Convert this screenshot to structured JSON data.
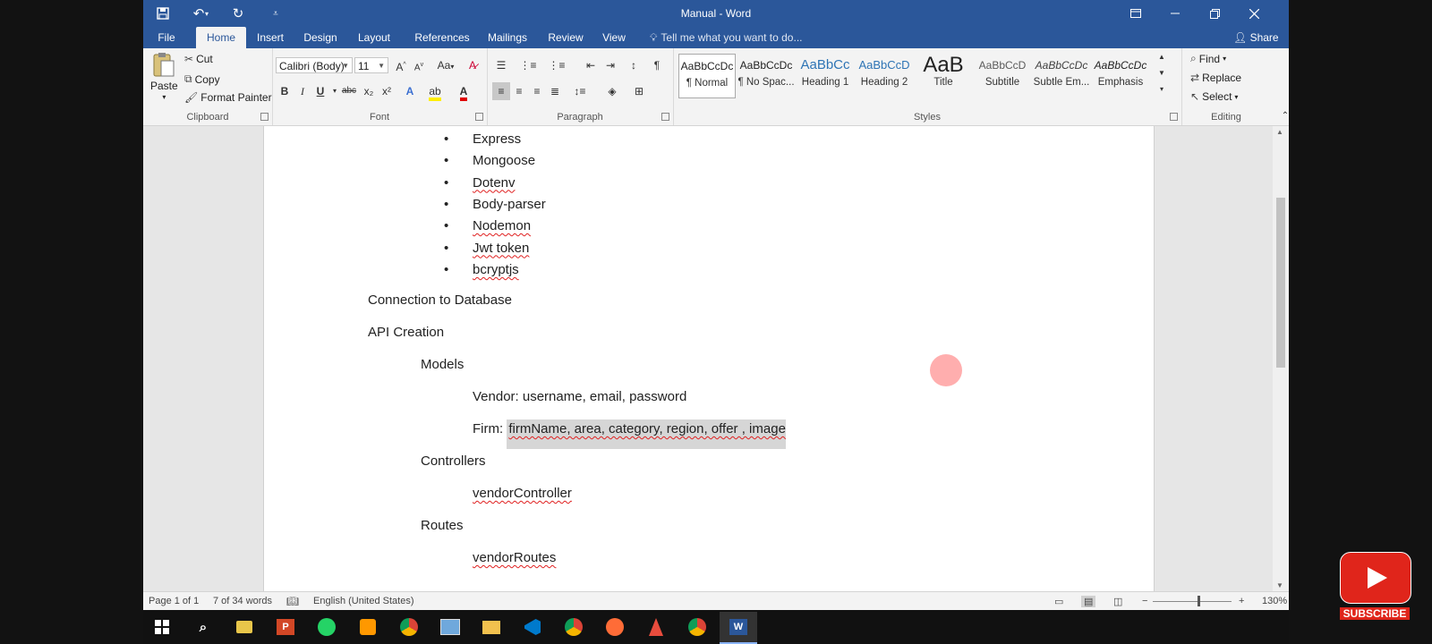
{
  "window": {
    "title": "Manual - Word",
    "quick_access": [
      "save-icon",
      "undo-icon",
      "redo-icon",
      "customize-icon"
    ],
    "controls": [
      "ribbon-display-icon",
      "minimize-icon",
      "restore-icon",
      "close-icon"
    ]
  },
  "tabs": {
    "file": "File",
    "home": "Home",
    "insert": "Insert",
    "design": "Design",
    "layout": "Layout",
    "references": "References",
    "mailings": "Mailings",
    "review": "Review",
    "view": "View",
    "tell_me": "Tell me what you want to do...",
    "share": "Share"
  },
  "clipboard": {
    "paste": "Paste",
    "cut": "Cut",
    "copy": "Copy",
    "format_painter": "Format Painter",
    "label": "Clipboard"
  },
  "font": {
    "family": "Calibri (Body)",
    "size": "11",
    "label": "Font",
    "bold": "B",
    "italic": "I",
    "underline": "U",
    "strike": "abc",
    "sub": "x₂",
    "sup": "x²",
    "case": "Aa"
  },
  "paragraph": {
    "label": "Paragraph"
  },
  "styles": {
    "label": "Styles",
    "items": [
      {
        "preview": "AaBbCcDc",
        "name": "¶ Normal"
      },
      {
        "preview": "AaBbCcDc",
        "name": "¶ No Spac..."
      },
      {
        "preview": "AaBbCc",
        "name": "Heading 1"
      },
      {
        "preview": "AaBbCcD",
        "name": "Heading 2"
      },
      {
        "preview": "AaB",
        "name": "Title"
      },
      {
        "preview": "AaBbCcD",
        "name": "Subtitle"
      },
      {
        "preview": "AaBbCcDc",
        "name": "Subtle Em..."
      },
      {
        "preview": "AaBbCcDc",
        "name": "Emphasis"
      }
    ]
  },
  "editing": {
    "find": "Find",
    "replace": "Replace",
    "select": "Select",
    "label": "Editing"
  },
  "document": {
    "bullets": [
      "Express",
      "Mongoose",
      "Dotenv",
      "Body-parser",
      "Nodemon",
      "Jwt token",
      "bcryptjs"
    ],
    "connection": "Connection to Database",
    "api": "API Creation",
    "models": "Models",
    "vendor_line": "Vendor: username, email, password",
    "firm_prefix": "Firm:",
    "firm_selected": "firmName, area, category, region, offer , image",
    "controllers": "Controllers",
    "vendor_controller": "vendorController",
    "routes": "Routes",
    "vendor_routes": "vendorRoutes"
  },
  "status": {
    "page": "Page 1 of 1",
    "words": "7 of 34 words",
    "language": "English (United States)",
    "zoom": "130%"
  },
  "taskbar": {
    "apps": [
      "windows-start-icon",
      "search-icon",
      "explorer-icon",
      "powerpoint-icon",
      "whatsapp-icon",
      "sublime-icon",
      "chrome-icon",
      "app-icon",
      "folder-icon",
      "vscode-icon",
      "chrome-icon",
      "postman-icon",
      "tool-icon",
      "chrome-icon",
      "word-icon"
    ]
  },
  "overlay": {
    "subscribe": "SUBSCRIBE"
  },
  "colors": {
    "word_blue": "#2b579a",
    "ribbon_bg": "#f3f3f3",
    "youtube_red": "#e0251b"
  }
}
